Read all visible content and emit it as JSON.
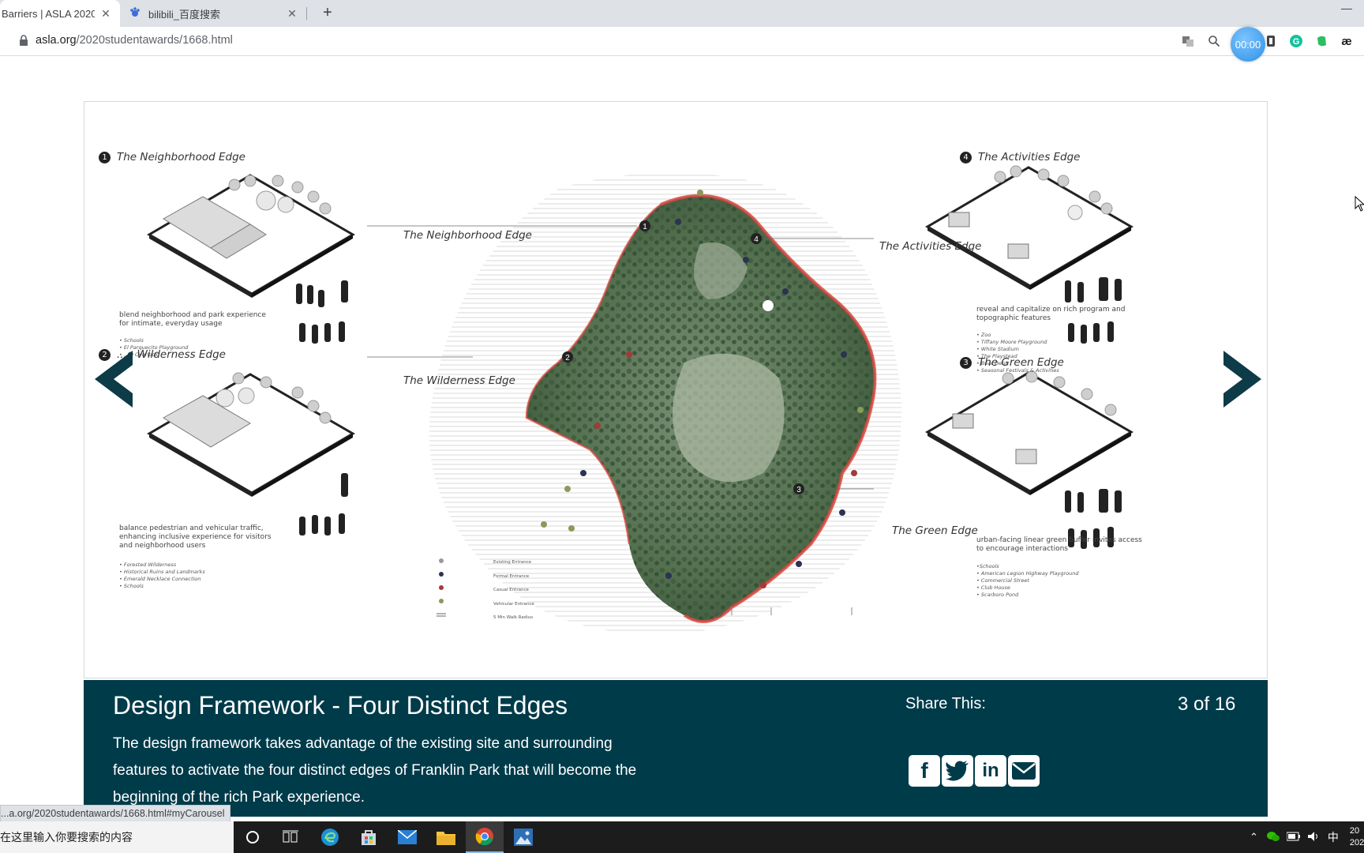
{
  "browser": {
    "tabs": [
      {
        "title": "Barriers | ASLA 2020",
        "active": true
      },
      {
        "title": "bilibili_百度搜索",
        "active": false
      }
    ],
    "url_host": "asla.org",
    "url_path": "/2020studentawards/1668.html",
    "timer": "00:00"
  },
  "poster": {
    "neighborhood": {
      "number": "1",
      "title": "The Neighborhood Edge",
      "desc": [
        "blend neighborhood and park experience",
        "for intimate, everyday usage"
      ],
      "bullets": [
        "• Schools",
        "• El Parquecito Playground",
        "• ...la Overlook"
      ]
    },
    "wilderness": {
      "number": "2",
      "title": "...e Wilderness Edge",
      "desc": [
        "balance pedestrian and vehicular traffic,",
        "enhancing inclusive experience for visitors",
        "and neighborhood users"
      ],
      "bullets": [
        "• Forested Wilderness",
        "• Historical Ruins and Landmarks",
        "• Emerald Necklace Connection",
        "• Schools"
      ]
    },
    "activities": {
      "number": "4",
      "title": "The Activities Edge",
      "desc": [
        "reveal and capitalize on rich program and",
        "topographic features"
      ],
      "bullets": [
        "• Zoo",
        "• Tiffany Moore Playground",
        "• White Stadium",
        "• The Playstead",
        "• Bear Dens",
        "• Seasonal Festivals & Activities"
      ]
    },
    "green": {
      "number": "3",
      "title": "The Green Edge",
      "desc": [
        "urban-facing linear green buffer invites access",
        "to encourage interactions"
      ],
      "bullets": [
        "•Schools",
        "• American Legion Highway Playground",
        "• Commercial Street",
        "• Club House",
        "• Scarboro Pond"
      ]
    },
    "map_labels": {
      "neighborhood": "The Neighborhood Edge",
      "wilderness": "The Wilderness Edge",
      "activities": "The Activities Edge",
      "green": "The Green Edge"
    },
    "map_markers": [
      "1",
      "2",
      "3",
      "4"
    ],
    "legend": [
      "Existing Entrance",
      "Formal Entrance",
      "Casual Entrance",
      "Vehicular Entrance",
      "5 Min Walk Radius"
    ]
  },
  "caption": {
    "title": "Design Framework - Four Distinct Edges",
    "description": "The design framework takes advantage of the existing site and surrounding features to activate the four distinct edges of Franklin Park that will become the beginning of the rich Park experience.",
    "share_label": "Share This:",
    "counter": "3 of 16"
  },
  "status_url": "...a.org/2020studentawards/1668.html#myCarousel",
  "taskbar": {
    "search_placeholder": "在这里输入你要搜索的内容",
    "ime": "中",
    "clock_line1": "20",
    "clock_line2": "202"
  },
  "colors": {
    "caption_bg": "#003b4a",
    "arrow": "#0d3b47",
    "edge_red": "#d9473f",
    "map_green": "#4f6b4f"
  }
}
